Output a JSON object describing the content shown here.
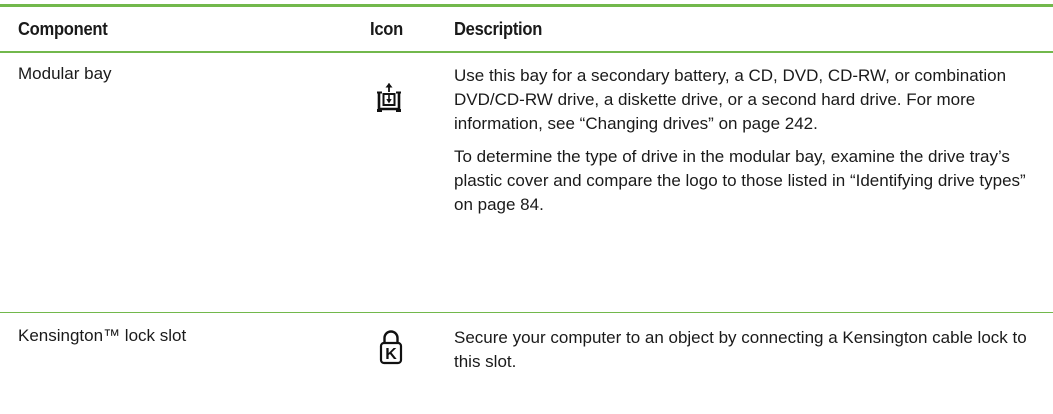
{
  "table": {
    "headers": {
      "component": "Component",
      "icon": "Icon",
      "description": "Description"
    },
    "rows": [
      {
        "component": "Modular bay",
        "icon": "modular-bay-icon",
        "description": [
          "Use this bay for a secondary battery, a CD, DVD, CD-RW, or combination DVD/CD-RW drive, a diskette drive, or a second hard drive. For more information, see “Changing drives” on page 242.",
          "To determine the type of drive in the modular bay, examine the drive tray’s plastic cover and compare the logo to those listed in “Identifying drive types” on page 84."
        ]
      },
      {
        "component": "Kensington™ lock slot",
        "icon": "kensington-lock-icon",
        "description": [
          "Secure your computer to an object by connecting a Kensington cable lock to this slot."
        ]
      }
    ]
  },
  "colors": {
    "rule": "#72b84c",
    "text": "#1a1a1a"
  }
}
